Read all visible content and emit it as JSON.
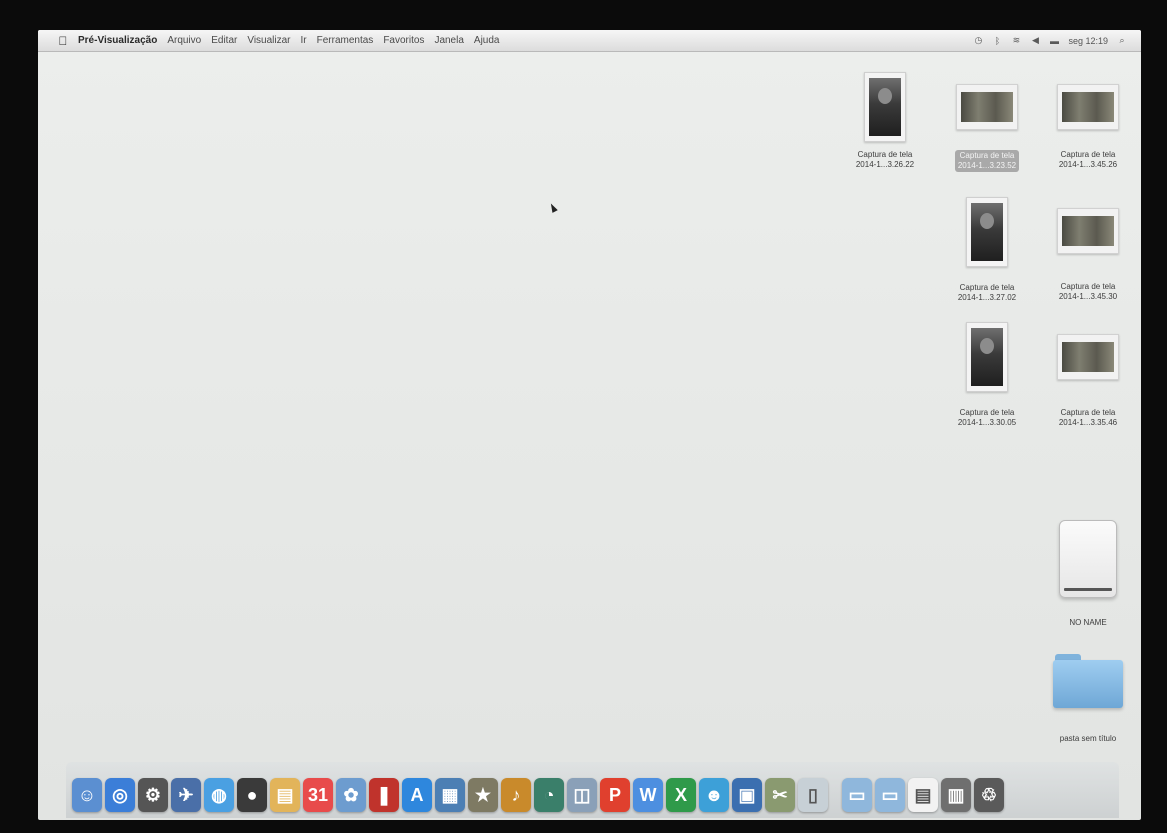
{
  "menubar": {
    "app_name": "Pré-Visualização",
    "menus": [
      "Arquivo",
      "Editar",
      "Visualizar",
      "Ir",
      "Ferramentas",
      "Favoritos",
      "Janela",
      "Ajuda"
    ],
    "status": {
      "datetime": "seg 12:19"
    }
  },
  "desktop": {
    "items": [
      {
        "type": "portrait",
        "label_1": "Captura de tela",
        "label_2": "2014-1...3.26.22",
        "selected": false
      },
      {
        "type": "landscape",
        "label_1": "Captura de tela",
        "label_2": "2014-1...3.23.52",
        "selected": true
      },
      {
        "type": "landscape",
        "label_1": "Captura de tela",
        "label_2": "2014-1...3.45.26",
        "selected": false
      },
      {
        "type": "portrait",
        "label_1": "Captura de tela",
        "label_2": "2014-1...3.27.02",
        "selected": false
      },
      {
        "type": "landscape",
        "label_1": "Captura de tela",
        "label_2": "2014-1...3.45.30",
        "selected": false
      },
      {
        "type": "portrait",
        "label_1": "Captura de tela",
        "label_2": "2014-1...3.30.05",
        "selected": false
      },
      {
        "type": "landscape",
        "label_1": "Captura de tela",
        "label_2": "2014-1...3.35.46",
        "selected": false
      }
    ],
    "drive_label": "NO NAME",
    "folder_label": "pasta sem título"
  },
  "dock": {
    "apps": [
      {
        "icon": "finder-icon",
        "color": "#5b8fd1",
        "glyph": "☺"
      },
      {
        "icon": "safari-icon",
        "color": "#3b7ed8",
        "glyph": "◎"
      },
      {
        "icon": "system-preferences-icon",
        "color": "#555555",
        "glyph": "⚙"
      },
      {
        "icon": "launchpad-icon",
        "color": "#4a6fa8",
        "glyph": "✈"
      },
      {
        "icon": "safari-browser-icon",
        "color": "#4aa0e2",
        "glyph": "◍"
      },
      {
        "icon": "camera-icon",
        "color": "#3a3a3a",
        "glyph": "●"
      },
      {
        "icon": "notes-icon",
        "color": "#e2b45a",
        "glyph": "▤"
      },
      {
        "icon": "calendar-icon",
        "color": "#e84b4b",
        "glyph": "31"
      },
      {
        "icon": "photos-icon",
        "color": "#6d9ccf",
        "glyph": "✿"
      },
      {
        "icon": "book-icon",
        "color": "#c0332c",
        "glyph": "❚"
      },
      {
        "icon": "app-store-icon",
        "color": "#2e87dd",
        "glyph": "A"
      },
      {
        "icon": "iphoto-icon",
        "color": "#4c7fb4",
        "glyph": "▦"
      },
      {
        "icon": "imovie-icon",
        "color": "#7e7a63",
        "glyph": "★"
      },
      {
        "icon": "garageband-icon",
        "color": "#c98a2b",
        "glyph": "♪"
      },
      {
        "icon": "time-machine-icon",
        "color": "#3a7f6a",
        "glyph": "◔"
      },
      {
        "icon": "preview-icon",
        "color": "#8aa0b8",
        "glyph": "◫"
      },
      {
        "icon": "powerpoint-icon",
        "color": "#e0402e",
        "glyph": "P"
      },
      {
        "icon": "word-icon",
        "color": "#4d8fe0",
        "glyph": "W"
      },
      {
        "icon": "excel-icon",
        "color": "#2f9a4a",
        "glyph": "X"
      },
      {
        "icon": "messenger-icon",
        "color": "#3da0d8",
        "glyph": "☻"
      },
      {
        "icon": "photo-booth-icon",
        "color": "#3b6fb0",
        "glyph": "▣"
      },
      {
        "icon": "utilities-icon",
        "color": "#8a9a70",
        "glyph": "✂"
      },
      {
        "icon": "trash-can-icon",
        "color": "#c7d0d6",
        "glyph": "▯"
      }
    ],
    "stacks": [
      {
        "icon": "applications-folder-icon",
        "color": "#8fb7dc",
        "glyph": "▭"
      },
      {
        "icon": "documents-folder-icon",
        "color": "#8fb7dc",
        "glyph": "▭"
      },
      {
        "icon": "document-stack-icon",
        "color": "#f2f2f2",
        "glyph": "▤"
      },
      {
        "icon": "screenshots-stack-icon",
        "color": "#6f6f6f",
        "glyph": "▥"
      },
      {
        "icon": "trash-icon",
        "color": "#5a5a5a",
        "glyph": "♲"
      }
    ]
  }
}
